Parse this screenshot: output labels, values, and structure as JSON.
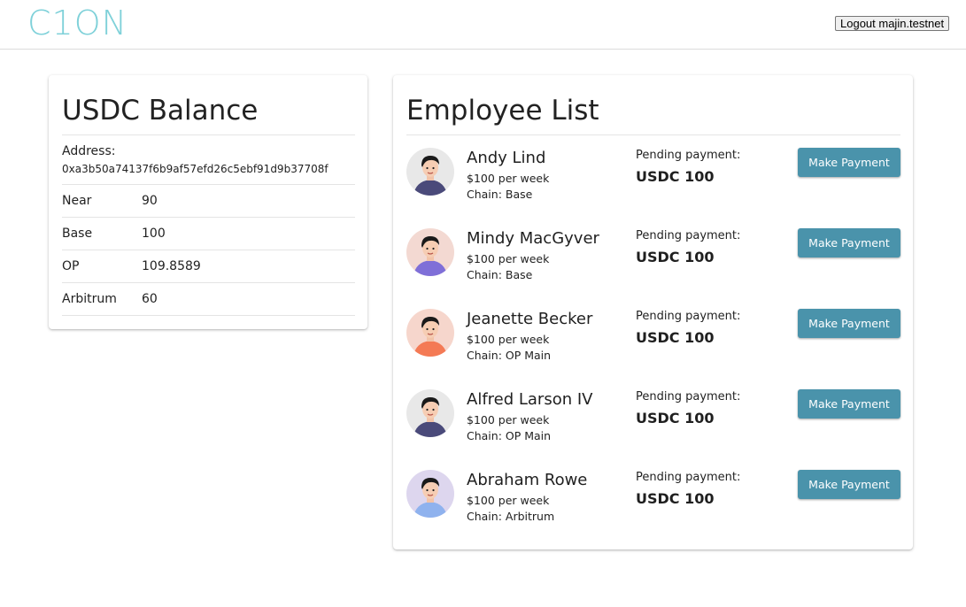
{
  "header": {
    "logo": "C1ON",
    "logout_label": "Logout majin.testnet"
  },
  "balance": {
    "title": "USDC Balance",
    "address_label": "Address:",
    "address_value": "0xa3b50a74137f6b9af57efd26c5ebf91d9b37708f",
    "rows": [
      {
        "chain": "Near",
        "amount": "90"
      },
      {
        "chain": "Base",
        "amount": "100"
      },
      {
        "chain": "OP",
        "amount": "109.8589"
      },
      {
        "chain": "Arbitrum",
        "amount": "60"
      }
    ]
  },
  "employees": {
    "title": "Employee List",
    "pending_label": "Pending payment:",
    "pay_button_label": "Make Payment",
    "items": [
      {
        "name": "Andy Lind",
        "rate": "$100 per week",
        "chain": "Chain: Base",
        "pending": "USDC 100",
        "avatar_bg": "#e8e8e8",
        "avatar_shirt": "#4a4a7a",
        "avatar_hair": "#1a1a1a"
      },
      {
        "name": "Mindy MacGyver",
        "rate": "$100 per week",
        "chain": "Chain: Base",
        "pending": "USDC 100",
        "avatar_bg": "#f3d9d2",
        "avatar_shirt": "#7f6fd8",
        "avatar_hair": "#1a1a1a"
      },
      {
        "name": "Jeanette Becker",
        "rate": "$100 per week",
        "chain": "Chain: OP Main",
        "pending": "USDC 100",
        "avatar_bg": "#f6d6cc",
        "avatar_shirt": "#f47a55",
        "avatar_hair": "#1a1a1a"
      },
      {
        "name": "Alfred Larson IV",
        "rate": "$100 per week",
        "chain": "Chain: OP Main",
        "pending": "USDC 100",
        "avatar_bg": "#e8e8e8",
        "avatar_shirt": "#4a4a7a",
        "avatar_hair": "#1a1a1a"
      },
      {
        "name": "Abraham Rowe",
        "rate": "$100 per week",
        "chain": "Chain: Arbitrum",
        "pending": "USDC 100",
        "avatar_bg": "#ddd6ee",
        "avatar_shirt": "#8fb2ee",
        "avatar_hair": "#1a1a1a"
      }
    ]
  }
}
